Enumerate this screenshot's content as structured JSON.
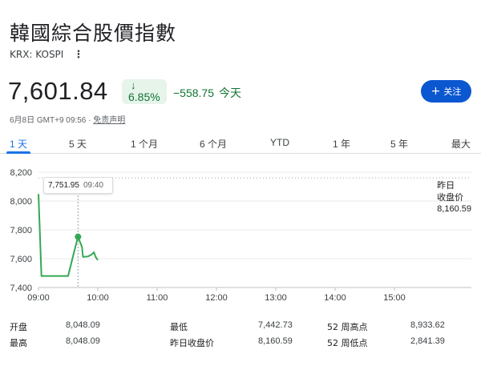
{
  "header": {
    "title": "韓國綜合股價指數",
    "ticker": "KRX: KOSPI",
    "more_icon": "⋮"
  },
  "quote": {
    "price": "7,601.84",
    "change_arrow": "↓",
    "change_pct": "6.85%",
    "change_abs": "−558.75",
    "change_period": "今天",
    "timestamp": "6月8日 GMT+9 09:56 · ",
    "disclaimer": "免责声明",
    "color_down": "#137333",
    "badge_bg": "#e6f4ea"
  },
  "follow": {
    "icon": "+",
    "label": "关注",
    "color": "#0b57d0"
  },
  "tabs": [
    {
      "label": "1 天",
      "active": true
    },
    {
      "label": "5 天"
    },
    {
      "label": "1 个月"
    },
    {
      "label": "6 个月"
    },
    {
      "label": "YTD"
    },
    {
      "label": "1 年"
    },
    {
      "label": "5 年"
    },
    {
      "label": "最大"
    }
  ],
  "tooltip": {
    "value": "7,751.95",
    "time": "09:40"
  },
  "prev_close_label": {
    "line1": "昨日",
    "line2": "收盘价",
    "value": "8,160.59"
  },
  "chart_data": {
    "type": "line",
    "x_ticks": [
      "09:00",
      "10:00",
      "11:00",
      "12:00",
      "13:00",
      "14:00",
      "15:00"
    ],
    "y_ticks": [
      "8,200",
      "8,000",
      "7,800",
      "7,600",
      "7,400"
    ],
    "y_tick_values": [
      8200,
      8000,
      7800,
      7600,
      7400
    ],
    "ylim": [
      7400,
      8200
    ],
    "xlim_minutes": [
      0,
      420
    ],
    "reference_line": 8160.59,
    "series": [
      {
        "color": "#34a853",
        "points": [
          [
            0,
            8048.09
          ],
          [
            3,
            7480
          ],
          [
            10,
            7480
          ],
          [
            20,
            7480
          ],
          [
            30,
            7480
          ],
          [
            35,
            7620
          ],
          [
            40,
            7751.95
          ],
          [
            44,
            7680
          ],
          [
            45,
            7612
          ],
          [
            50,
            7615
          ],
          [
            54,
            7630
          ],
          [
            56,
            7645
          ],
          [
            58,
            7610
          ],
          [
            60,
            7590
          ]
        ]
      }
    ],
    "highlight_point": [
      40,
      7751.95
    ]
  },
  "stats": [
    [
      {
        "label": "开盘",
        "value": "8,048.09"
      },
      {
        "label": "最低",
        "value": "7,442.73"
      },
      {
        "label": "52 周高点",
        "value": "8,933.62"
      }
    ],
    [
      {
        "label": "最高",
        "value": "8,048.09"
      },
      {
        "label": "昨日收盘价",
        "value": "8,160.59"
      },
      {
        "label": "52 周低点",
        "value": "2,841.39"
      }
    ]
  ]
}
